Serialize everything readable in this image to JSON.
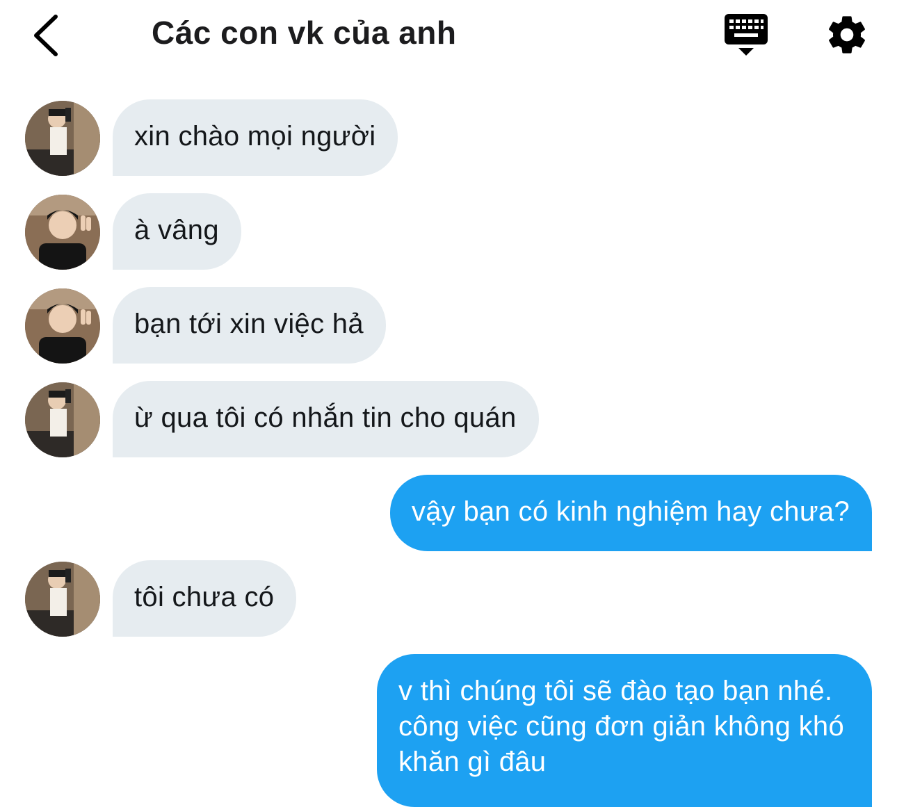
{
  "header": {
    "title": "Các con vk của anh",
    "back_icon": "chevron-left-icon",
    "keyboard_icon": "keyboard-icon",
    "settings_icon": "gear-icon"
  },
  "colors": {
    "incoming_bubble": "#e6ecf0",
    "outgoing_bubble": "#1da1f2",
    "text_dark": "#14171a",
    "text_light": "#ffffff"
  },
  "messages": [
    {
      "direction": "in",
      "avatar": "avatar-mirror-selfie",
      "text": "xin chào mọi người"
    },
    {
      "direction": "in",
      "avatar": "avatar-peace-sign",
      "text": "à vâng"
    },
    {
      "direction": "in",
      "avatar": "avatar-peace-sign",
      "text": "bạn tới xin việc hả"
    },
    {
      "direction": "in",
      "avatar": "avatar-mirror-selfie",
      "text": "ừ qua tôi có nhắn tin cho quán"
    },
    {
      "direction": "out",
      "text": "vậy bạn có kinh nghiệm hay chưa?"
    },
    {
      "direction": "in",
      "avatar": "avatar-mirror-selfie",
      "text": "tôi chưa có"
    },
    {
      "direction": "out",
      "lines": [
        "v thì chúng tôi sẽ đào tạo bạn nhé.",
        "công việc cũng đơn giản không khó",
        "khăn gì đâu"
      ]
    }
  ]
}
